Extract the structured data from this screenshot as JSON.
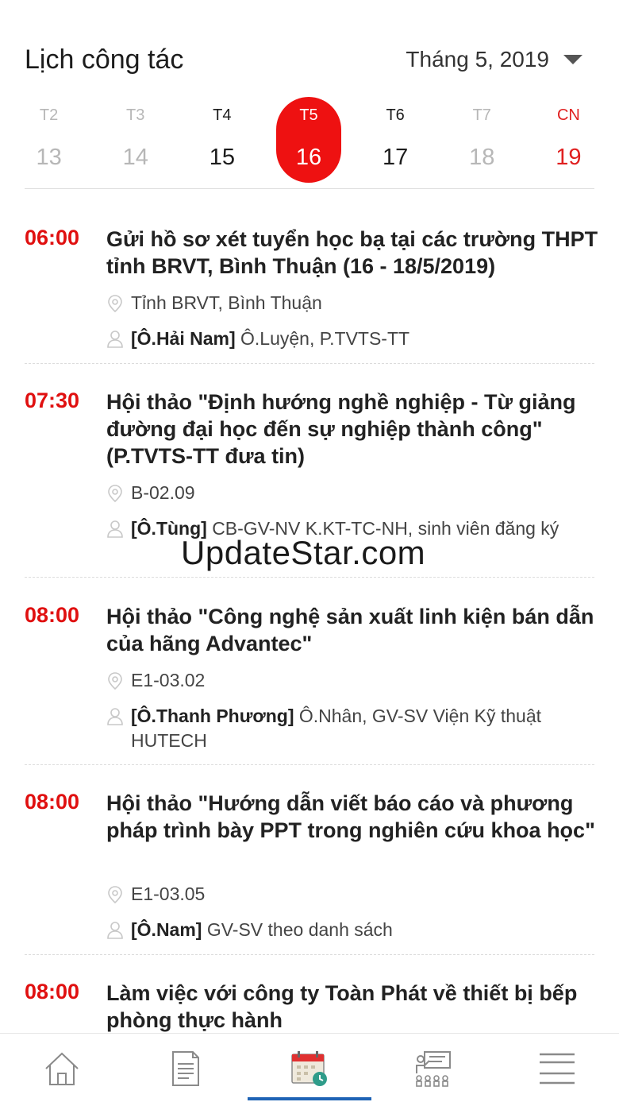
{
  "header": {
    "title": "Lịch công tác",
    "month": "Tháng 5, 2019"
  },
  "week": [
    {
      "dow": "T2",
      "date": "13",
      "state": "muted"
    },
    {
      "dow": "T3",
      "date": "14",
      "state": "muted"
    },
    {
      "dow": "T4",
      "date": "15",
      "state": "normal"
    },
    {
      "dow": "T5",
      "date": "16",
      "state": "selected"
    },
    {
      "dow": "T6",
      "date": "17",
      "state": "normal"
    },
    {
      "dow": "T7",
      "date": "18",
      "state": "muted"
    },
    {
      "dow": "CN",
      "date": "19",
      "state": "sunday"
    }
  ],
  "events": [
    {
      "time": "06:00",
      "title": "Gửi hồ sơ xét tuyển học bạ tại các trường THPT tỉnh BRVT, Bình Thuận (16 - 18/5/2019)",
      "location": "Tỉnh BRVT, Bình Thuận",
      "host": "[Ô.Hải Nam]",
      "participants": "Ô.Luyện, P.TVTS-TT"
    },
    {
      "time": "07:30",
      "title": "Hội thảo \"Định hướng nghề nghiệp - Từ giảng đường đại học đến sự nghiệp thành công\" (P.TVTS-TT đưa tin)",
      "location": "B-02.09",
      "host": "[Ô.Tùng]",
      "participants": "CB-GV-NV K.KT-TC-NH, sinh viên đăng ký"
    },
    {
      "time": "08:00",
      "title": "Hội thảo \"Công nghệ sản xuất linh kiện bán dẫn của hãng Advantec\"",
      "location": "E1-03.02",
      "host": "[Ô.Thanh Phương]",
      "participants": "Ô.Nhân, GV-SV Viện Kỹ thuật HUTECH"
    },
    {
      "time": "08:00",
      "title": "Hội thảo \"Hướng dẫn viết báo cáo và phương pháp trình bày PPT trong nghiên cứu khoa học\"",
      "location": "E1-03.05",
      "host": "[Ô.Nam]",
      "participants": "GV-SV theo danh sách"
    },
    {
      "time": "08:00",
      "title": "Làm việc với công ty Toàn Phát về thiết bị bếp phòng thực hành",
      "location": "",
      "host": "",
      "participants": ""
    }
  ],
  "watermark": "UpdateStar.com",
  "tabs": [
    {
      "icon": "home-icon",
      "active": false
    },
    {
      "icon": "document-icon",
      "active": false
    },
    {
      "icon": "calendar-clock-icon",
      "active": true
    },
    {
      "icon": "presentation-icon",
      "active": false
    },
    {
      "icon": "menu-icon",
      "active": false
    }
  ],
  "colors": {
    "accent": "#ee1111",
    "time": "#e01010",
    "tab_active": "#1e63b5",
    "muted": "#b7b7b7"
  }
}
